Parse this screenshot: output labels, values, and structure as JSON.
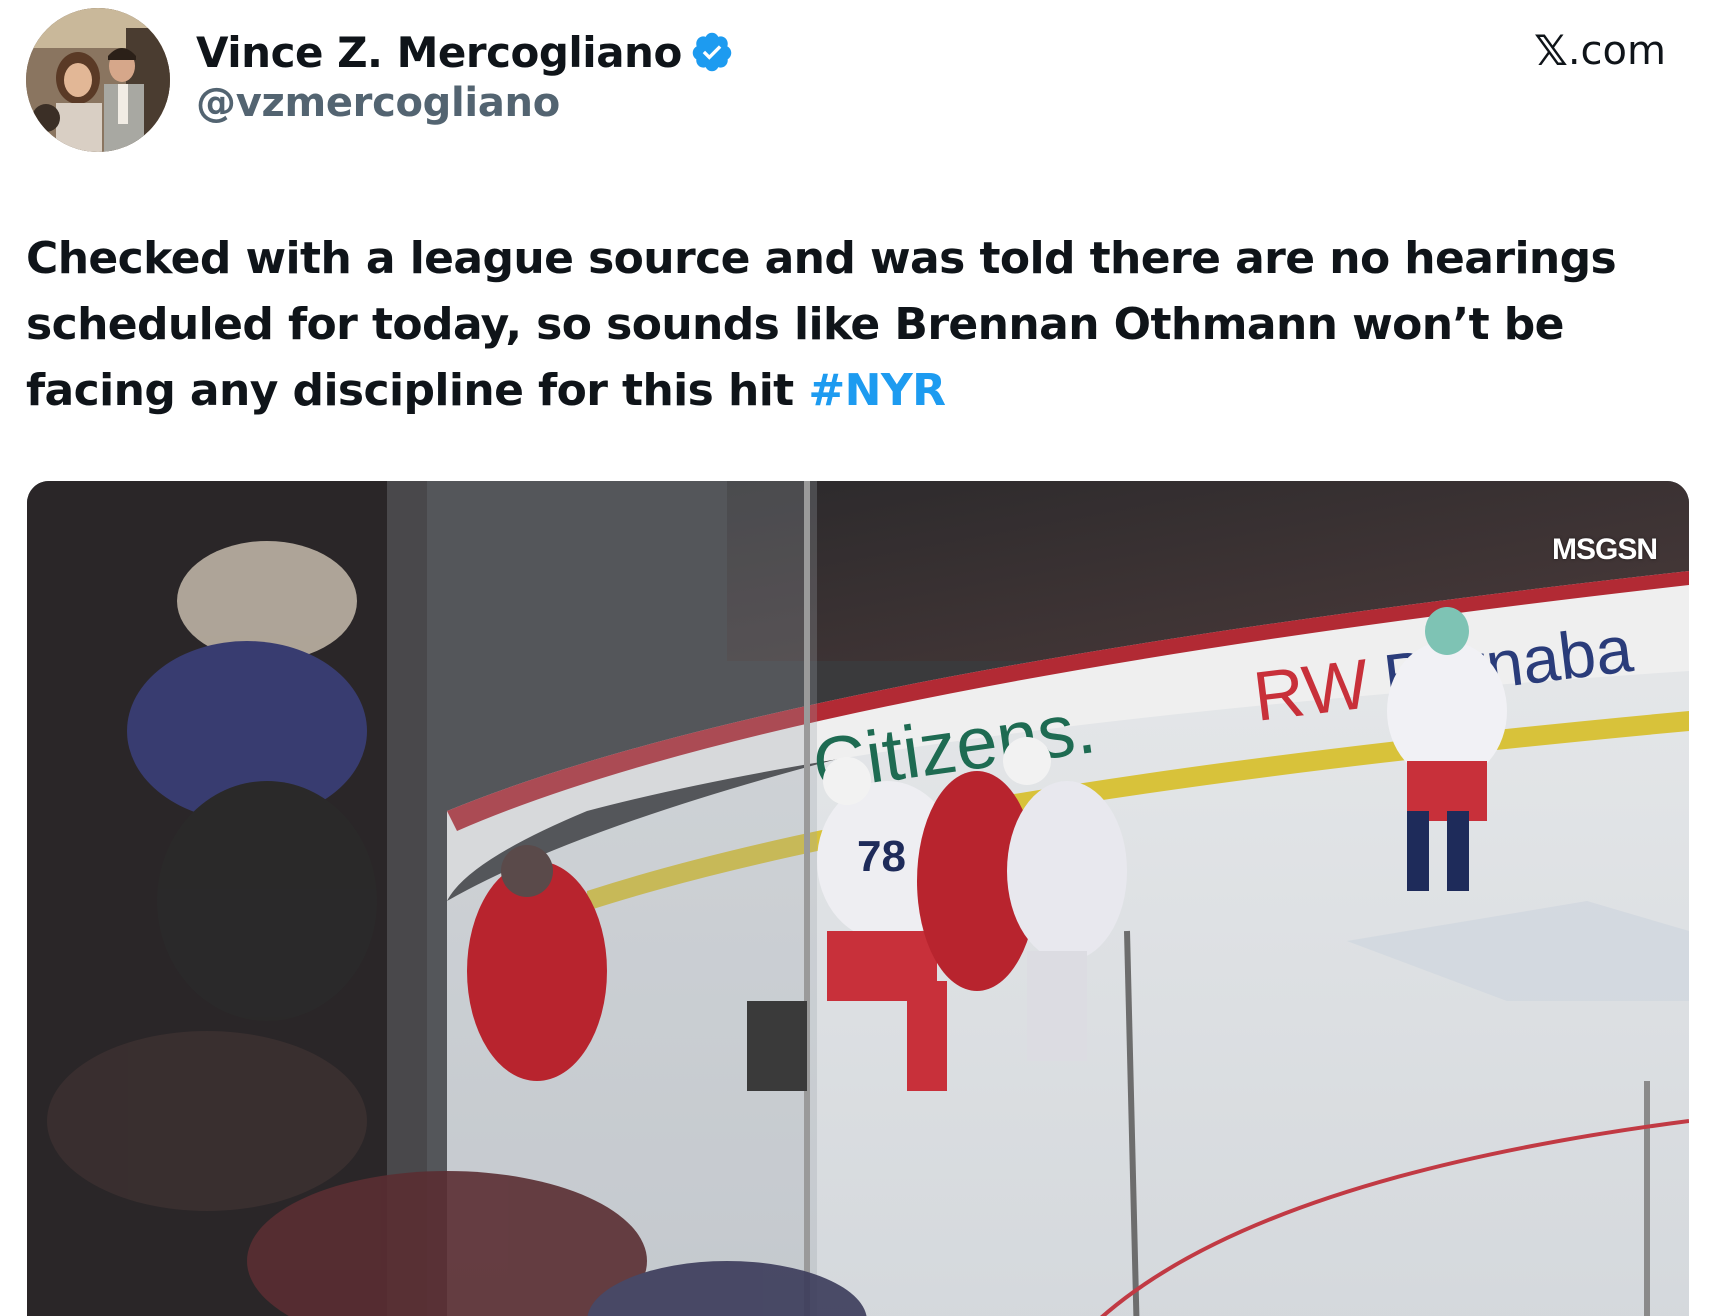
{
  "author": {
    "display_name": "Vince Z. Mercogliano",
    "handle": "@vzmercogliano",
    "verified": true
  },
  "source": {
    "glyph": "𝕏",
    "suffix": ".com"
  },
  "tweet": {
    "text": "Checked with a league source and was told there are no hearings scheduled for today, so sounds like Brennan Othmann won’t be facing any discipline for this hit ",
    "hashtag": "#NYR"
  },
  "media": {
    "broadcaster_logo": "MSGSN"
  },
  "colors": {
    "text": "#0f1419",
    "secondary": "#536471",
    "accent": "#1d9bf0"
  },
  "icons": {
    "verified": "verified-badge-icon"
  }
}
